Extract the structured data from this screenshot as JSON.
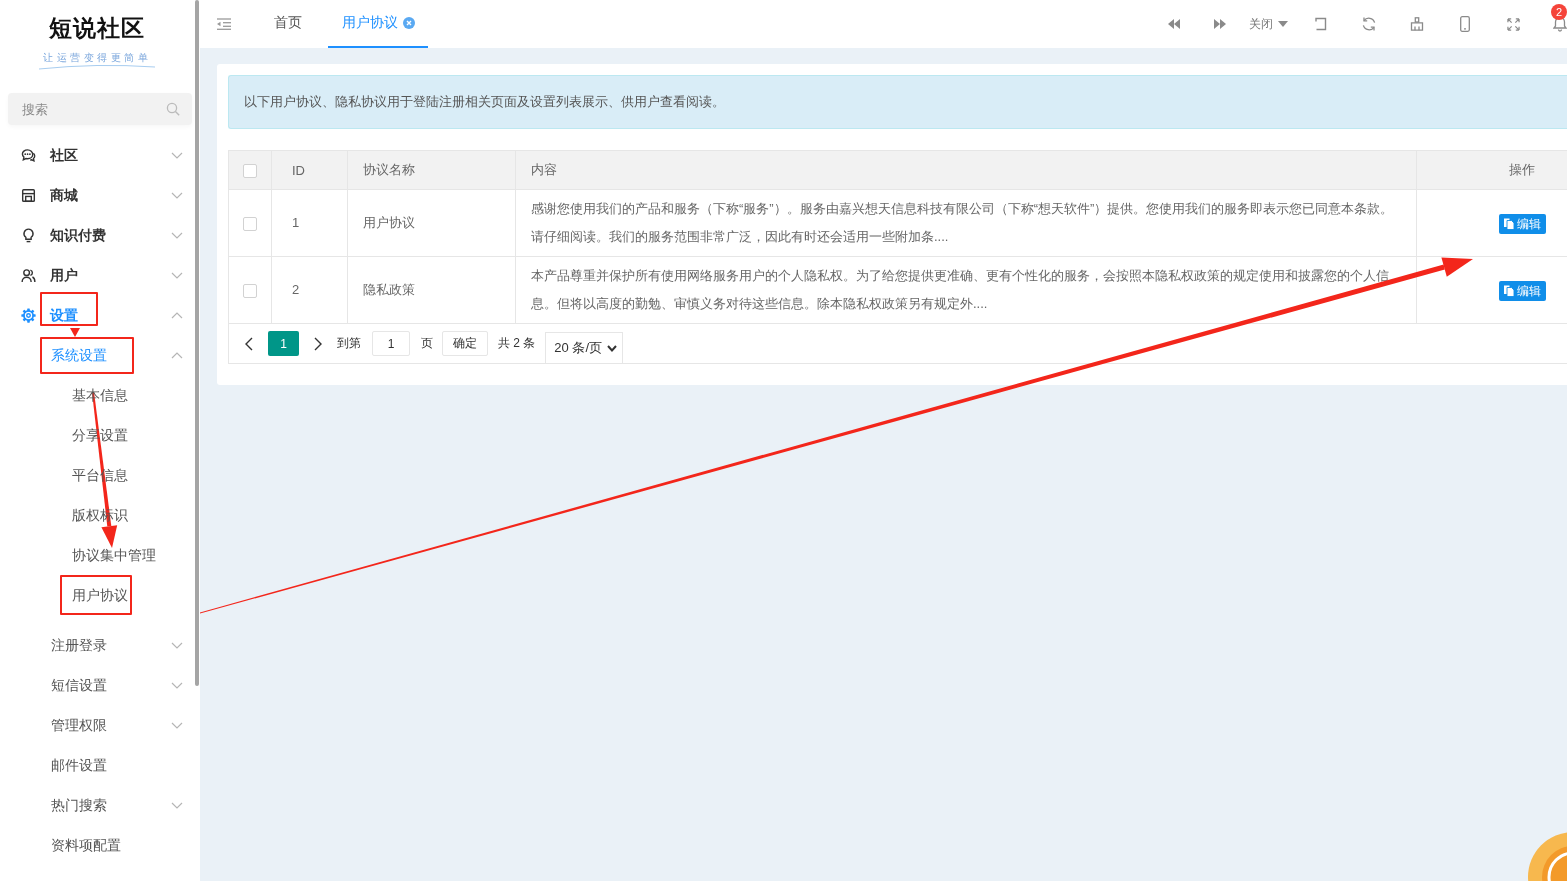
{
  "sidebar": {
    "logo": {
      "title": "短说社区",
      "tagline": "让运营变得更简单"
    },
    "search": {
      "placeholder": "搜索"
    },
    "items": [
      {
        "label": "社区",
        "active": false,
        "expanded": false,
        "marked": false
      },
      {
        "label": "商城",
        "active": false,
        "expanded": false,
        "marked": false
      },
      {
        "label": "知识付费",
        "active": false,
        "expanded": false,
        "marked": false
      },
      {
        "label": "用户",
        "active": false,
        "expanded": false,
        "marked": false
      },
      {
        "label": "设置",
        "active": true,
        "expanded": true,
        "marked": true,
        "children": [
          {
            "label": "系统设置",
            "kind": "group",
            "active": true,
            "expanded": true,
            "marked": true,
            "children": [
              {
                "label": "基本信息",
                "active": false,
                "marked": false
              },
              {
                "label": "分享设置",
                "active": false,
                "marked": false
              },
              {
                "label": "平台信息",
                "active": false,
                "marked": false
              },
              {
                "label": "版权标识",
                "active": false,
                "marked": false
              },
              {
                "label": "协议集中管理",
                "active": false,
                "marked": false
              },
              {
                "label": "用户协议",
                "active": false,
                "marked": true
              }
            ]
          },
          {
            "label": "注册登录",
            "kind": "group",
            "active": false,
            "expanded": false,
            "marked": false
          },
          {
            "label": "短信设置",
            "kind": "group",
            "active": false,
            "expanded": false,
            "marked": false
          },
          {
            "label": "管理权限",
            "kind": "group",
            "active": false,
            "expanded": false,
            "marked": false
          },
          {
            "label": "邮件设置",
            "kind": "link",
            "active": false,
            "marked": false
          },
          {
            "label": "热门搜索",
            "kind": "group",
            "active": false,
            "expanded": false,
            "marked": false
          },
          {
            "label": "资料项配置",
            "kind": "link",
            "active": false,
            "marked": false
          }
        ]
      }
    ]
  },
  "topbar": {
    "tabs": [
      {
        "label": "首页",
        "selected": false,
        "closable": false
      },
      {
        "label": "用户协议",
        "selected": true,
        "closable": true
      }
    ],
    "close_menu": "关闭",
    "notification_badge": "2"
  },
  "content": {
    "notice": "以下用户协议、隐私协议用于登陆注册相关页面及设置列表展示、供用户查看阅读。",
    "table": {
      "header_checked": false,
      "columns": [
        "ID",
        "协议名称",
        "内容",
        "操作"
      ],
      "rows": [
        {
          "checked": false,
          "id": "1",
          "name": "用户协议",
          "content": "感谢您使用我们的产品和服务（下称“服务”）。服务由嘉兴想天信息科技有限公司（下称“想天软件”）提供。您使用我们的服务即表示您已同意本条款。请仔细阅读。我们的服务范围非常广泛，因此有时还会适用一些附加条....",
          "action": "编辑"
        },
        {
          "checked": false,
          "id": "2",
          "name": "隐私政策",
          "content": "本产品尊重并保护所有使用网络服务用户的个人隐私权。为了给您提供更准确、更有个性化的服务，会按照本隐私权政策的规定使用和披露您的个人信息。但将以高度的勤勉、审慎义务对待这些信息。除本隐私权政策另有规定外....",
          "action": "编辑"
        }
      ]
    },
    "pagination": {
      "pages": [
        {
          "label": "1",
          "selected": true
        }
      ],
      "goto_label": "到第",
      "goto_value": "1",
      "page_unit": "页",
      "confirm": "确定",
      "total": "共 2 条",
      "page_size": "20 条/页"
    }
  }
}
